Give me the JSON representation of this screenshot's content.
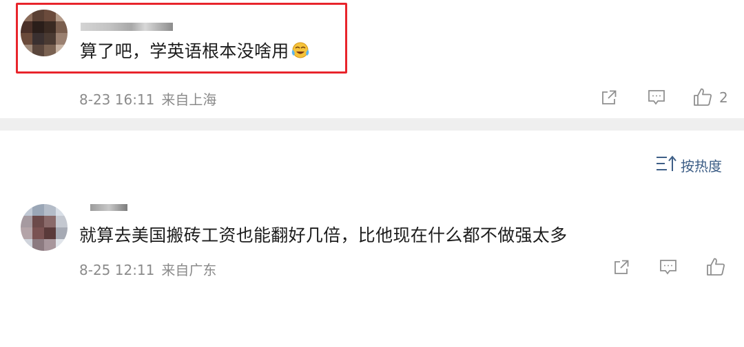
{
  "sort": {
    "icon": "sort-icon",
    "label": "按热度"
  },
  "comments": [
    {
      "text": "算了吧，学英语根本没啥用",
      "emoji": "laughing-crying-emoji",
      "time": "8-23 16:11",
      "location": "来自上海",
      "likes": "2",
      "highlighted": true
    },
    {
      "text": "就算去美国搬砖工资也能翻好几倍，比他现在什么都不做强太多",
      "time": "8-25 12:11",
      "location": "来自广东",
      "likes": "",
      "highlighted": false
    }
  ],
  "colors": {
    "highlight": "#e8242b",
    "sort_text": "#3d5e86",
    "meta_text": "#8a8a8a",
    "divider": "#efefef"
  }
}
